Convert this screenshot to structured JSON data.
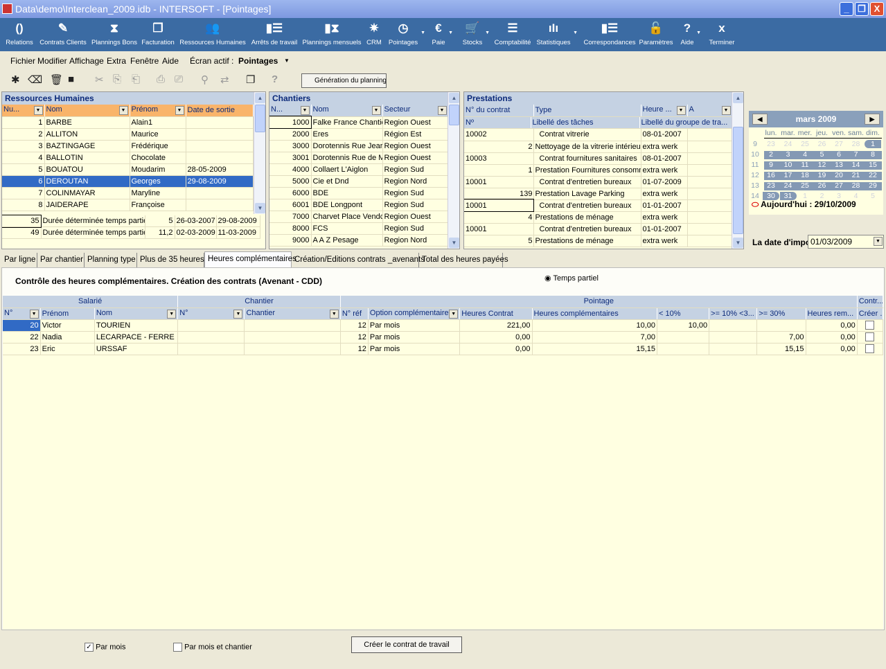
{
  "window": {
    "title": "Data\\demo\\Interclean_2009.idb - INTERSOFT - [Pointages]",
    "minimize": "_",
    "restore": "❐",
    "close": "X"
  },
  "iconbar": [
    {
      "label": "Relations",
      "icon": "relations-icon",
      "glyph": "()"
    },
    {
      "label": "Contrats Clients",
      "icon": "pencil-icon",
      "glyph": "✎"
    },
    {
      "label": "Plannings Bons",
      "icon": "hourglass-icon",
      "glyph": "⧗"
    },
    {
      "label": "Facturation",
      "icon": "windows-icon",
      "glyph": "❐"
    },
    {
      "label": "Ressources Humaines",
      "icon": "people-icon",
      "glyph": "👥"
    },
    {
      "label": "Arrêts de travail",
      "icon": "person-doc-icon",
      "glyph": "▮☰"
    },
    {
      "label": "Plannings mensuels",
      "icon": "person-hourglass-icon",
      "glyph": "▮⧗"
    },
    {
      "label": "CRM",
      "icon": "star-burst-icon",
      "glyph": "✷"
    },
    {
      "label": "Pointages",
      "icon": "clock-icon",
      "glyph": "◷",
      "dropdown": true
    },
    {
      "label": "Paie",
      "icon": "euro-icon",
      "glyph": "€",
      "dropdown": true
    },
    {
      "label": "Stocks",
      "icon": "cart-icon",
      "glyph": "🛒",
      "dropdown": true
    },
    {
      "label": "Comptabilité",
      "icon": "document-icon",
      "glyph": "☰"
    },
    {
      "label": "Statistiques",
      "icon": "bar-chart-icon",
      "glyph": "ıIı",
      "dropdown": true
    },
    {
      "label": "Correspondances",
      "icon": "correspondence-icon",
      "glyph": "▮☰"
    },
    {
      "label": "Paramètres",
      "icon": "unlock-icon",
      "glyph": "🔓"
    },
    {
      "label": "Aide",
      "icon": "help-icon",
      "glyph": "?",
      "dropdown": true
    },
    {
      "label": "Terminer",
      "icon": "close-x-icon",
      "glyph": "x"
    }
  ],
  "menu": {
    "items": [
      "Fichier",
      "Modifier",
      "Affichage",
      "Extra",
      "Fenêtre",
      "Aide"
    ],
    "active_label": "Écran actif :",
    "active_value": "Pointages"
  },
  "toolbar": {
    "generate_label": "Génération du planning"
  },
  "rh": {
    "title": "Ressources Humaines",
    "columns": [
      "Nu...",
      "Nom",
      "Prénom",
      "Date de sortie"
    ],
    "rows": [
      [
        "1",
        "BARBE",
        "Alain1",
        ""
      ],
      [
        "2",
        "ALLITON",
        "Maurice",
        ""
      ],
      [
        "3",
        "BAZTINGAGE",
        "Frédérique",
        ""
      ],
      [
        "4",
        "BALLOTIN",
        "Chocolate",
        ""
      ],
      [
        "5",
        "BOUATOU",
        "Moudarim",
        "28-05-2009"
      ],
      [
        "6",
        "DEROUTAN",
        "Georges",
        "29-08-2009"
      ],
      [
        "7",
        "COLINMAYAR",
        "Maryline",
        ""
      ],
      [
        "8",
        "JAIDERAPE",
        "Françoise",
        ""
      ]
    ],
    "selected_index": 5,
    "contracts": [
      [
        "35",
        "Durée déterminée temps partie",
        "5",
        "26-03-2007",
        "29-08-2009"
      ],
      [
        "49",
        "Durée déterminée temps partie",
        "11,2",
        "02-03-2009",
        "11-03-2009"
      ]
    ]
  },
  "chantiers": {
    "title": "Chantiers",
    "columns": [
      "N...",
      "Nom",
      "Secteur"
    ],
    "rows": [
      [
        "1000",
        "Falke France Chantie",
        "Region Ouest"
      ],
      [
        "2000",
        "Eres",
        "Région Est"
      ],
      [
        "3000",
        "Dorotennis Rue Jear",
        "Region Ouest"
      ],
      [
        "3001",
        "Dorotennis Rue de M",
        "Region Ouest"
      ],
      [
        "4000",
        "Collaert L'Aiglon",
        "Region Sud"
      ],
      [
        "5000",
        "Cie et Dnd",
        "Region Nord"
      ],
      [
        "6000",
        "BDE",
        "Region Sud"
      ],
      [
        "6001",
        "BDE Longpont",
        "Region Sud"
      ],
      [
        "7000",
        "Charvet Place Vendc",
        "Region Ouest"
      ],
      [
        "8000",
        "FCS",
        "Region Sud"
      ],
      [
        "9000",
        "A A Z Pesage",
        "Region Nord"
      ]
    ]
  },
  "prestations": {
    "title": "Prestations",
    "columns1": [
      "N° du contrat",
      "Type",
      "Heure ...",
      "A"
    ],
    "columns2": [
      "Nº",
      "Libellé des tâches",
      "Libellé du groupe de tra..."
    ],
    "rows": [
      [
        "10002",
        "Contrat vitrerie",
        "08-01-2007",
        false
      ],
      [
        "2",
        "Nettoyage de la vitrerie intérieure",
        "extra werk",
        true
      ],
      [
        "10003",
        "Contrat fournitures sanitaires",
        "08-01-2007",
        false
      ],
      [
        "1",
        "Prestation Fournitures consomma",
        "extra werk",
        true
      ],
      [
        "10001",
        "Contrat d'entretien bureaux",
        "01-07-2009",
        false
      ],
      [
        "139",
        "Prestation Lavage Parking",
        "extra werk",
        true
      ],
      [
        "10001",
        "Contrat d'entretien bureaux",
        "01-01-2007",
        false
      ],
      [
        "4",
        "Prestations de ménage",
        "extra werk",
        true
      ],
      [
        "10001",
        "Contrat d'entretien bureaux",
        "01-01-2007",
        false
      ],
      [
        "5",
        "Prestations de ménage",
        "extra werk",
        true
      ]
    ]
  },
  "calendar": {
    "month": "mars 2009",
    "weekdays": [
      "lun.",
      "mar.",
      "mer.",
      "jeu.",
      "ven.",
      "sam.",
      "dim."
    ],
    "weeks": [
      "9",
      "10",
      "11",
      "12",
      "13",
      "14"
    ],
    "days": [
      [
        "23",
        "24",
        "25",
        "26",
        "27",
        "28",
        "1"
      ],
      [
        "2",
        "3",
        "4",
        "5",
        "6",
        "7",
        "8"
      ],
      [
        "9",
        "10",
        "11",
        "12",
        "13",
        "14",
        "15"
      ],
      [
        "16",
        "17",
        "18",
        "19",
        "20",
        "21",
        "22"
      ],
      [
        "23",
        "24",
        "25",
        "26",
        "27",
        "28",
        "29"
      ],
      [
        "30",
        "31",
        "1",
        "2",
        "3",
        "4",
        "5"
      ]
    ],
    "today": "Aujourd'hui : 29/10/2009",
    "date_label": "La date d'impo",
    "date_value": "01/03/2009"
  },
  "tabs": [
    "Par ligne",
    "Par chantier",
    "Planning type",
    "Plus de 35 heures",
    "Heures complémentaires",
    "Création/Editions contrats _avenants",
    "Total des heures payées"
  ],
  "active_tab": 4,
  "main": {
    "heading": "Contrôle des heures complémentaires. Création des contrats (Avenant - CDD)",
    "radio_label": "Temps partiel",
    "groups": [
      "Salarié",
      "Chantier",
      "Pointage",
      "Contr..."
    ],
    "columns": [
      "N°",
      "Prénom",
      "Nom",
      "N°",
      "Chantier",
      "N° réf",
      "Option complémentaire",
      "Heures Contrat",
      "Heures complémentaires",
      "< 10%",
      ">= 10% <3...",
      ">= 30%",
      "Heures rem...",
      "Créer ..."
    ],
    "rows": [
      [
        "20",
        "Victor",
        "TOURIEN",
        "",
        "",
        "12",
        "Par mois",
        "221,00",
        "10,00",
        "10,00",
        "",
        "",
        "0,00"
      ],
      [
        "22",
        "Nadia",
        "LECARPACE - FERRE",
        "",
        "",
        "12",
        "Par mois",
        "0,00",
        "7,00",
        "",
        "",
        "7,00",
        "0,00"
      ],
      [
        "23",
        "Eric",
        "URSSAF",
        "",
        "",
        "12",
        "Par mois",
        "0,00",
        "15,15",
        "",
        "",
        "15,15",
        "0,00"
      ]
    ],
    "check_par_mois": "Par mois",
    "check_par_mois_checked": true,
    "check_par_mois_chantier": "Par mois et chantier",
    "check_par_mois_chantier_checked": false,
    "create_button": "Créer le contrat de travail"
  },
  "colors": {
    "accent": "#3b6ba3",
    "selection": "#316ac5",
    "grid_bg": "#ffffe1",
    "header": "#c5d2e3",
    "rh_header": "#f9b46a"
  }
}
